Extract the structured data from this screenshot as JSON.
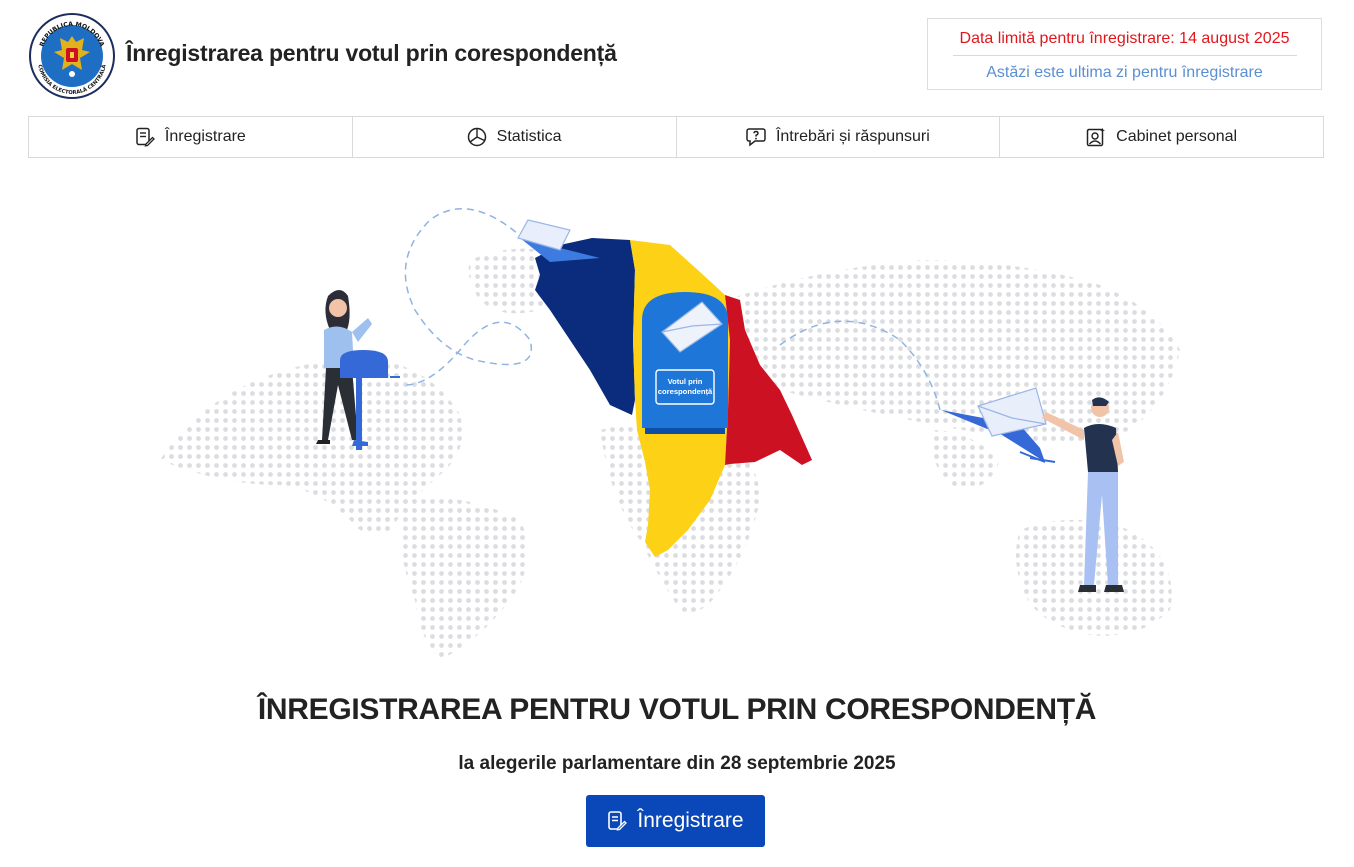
{
  "header": {
    "title": "Înregistrarea pentru votul prin corespondență",
    "logo_text_top": "REPUBLICA MOLDOVA",
    "logo_text_bottom": "COMISIA ELECTORALĂ CENTRALĂ",
    "deadline": "Data limită pentru înregistrare: 14 august 2025",
    "deadline_note": "Astăzi este ultima zi pentru înregistrare"
  },
  "nav": {
    "items": [
      {
        "label": "Înregistrare",
        "icon": "form-edit-icon"
      },
      {
        "label": "Statistica",
        "icon": "pie-chart-icon"
      },
      {
        "label": "Întrebări și răspunsuri",
        "icon": "question-bubble-icon"
      },
      {
        "label": "Cabinet personal",
        "icon": "user-card-icon"
      }
    ]
  },
  "hero": {
    "mailbox_label_1": "Votul prin",
    "mailbox_label_2": "corespondență"
  },
  "main": {
    "heading": "ÎNREGISTRAREA PENTRU VOTUL PRIN CORESPONDENȚĂ",
    "subheading": "la alegerile parlamentare din 28 septembrie 2025",
    "register_label": "Înregistrare"
  },
  "colors": {
    "deadline_red": "#e3161b",
    "note_blue": "#5b8fd3",
    "button_blue": "#0a47b8",
    "flag_blue": "#0b2b7c",
    "flag_yellow": "#fcd116",
    "flag_red": "#cc1222"
  }
}
